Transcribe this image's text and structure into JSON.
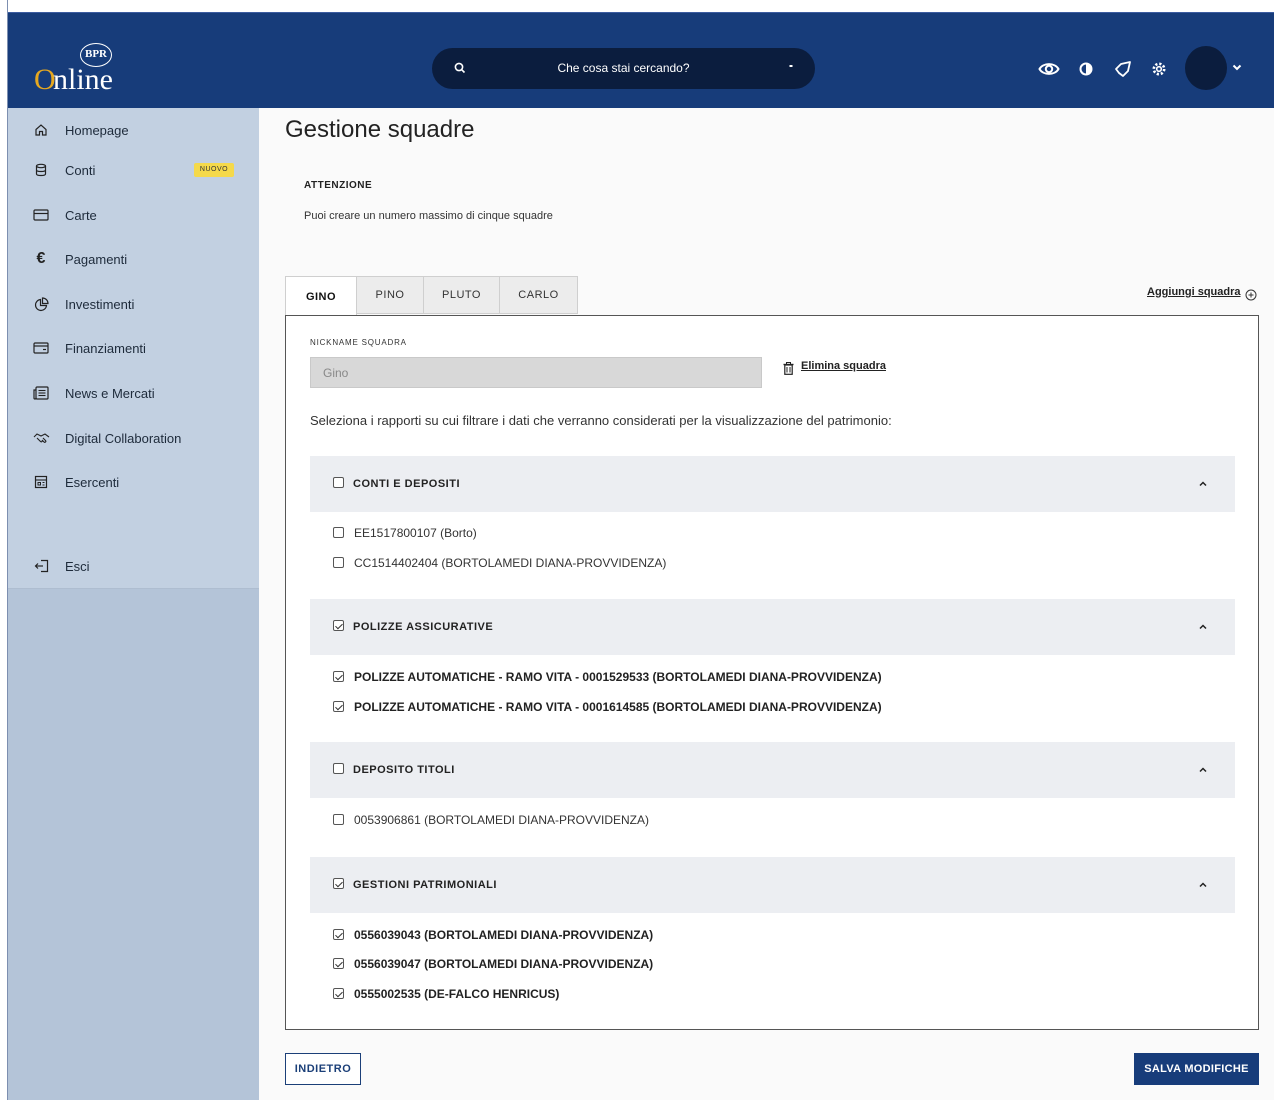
{
  "header": {
    "logo_text_o": "O",
    "logo_text_rest": "nline",
    "logo_seal": "BPR",
    "search_placeholder": "Che cosa stai cercando?",
    "icons": [
      "search-icon",
      "eye-icon",
      "contrast-icon",
      "rocket-icon",
      "gear-icon",
      "avatar",
      "chevron-down-icon"
    ]
  },
  "sidebar": {
    "items": [
      {
        "label": "Homepage",
        "icon": "home-icon"
      },
      {
        "label": "Conti",
        "icon": "database-icon",
        "badge": "NUOVO"
      },
      {
        "label": "Carte",
        "icon": "card-icon"
      },
      {
        "label": "Pagamenti",
        "icon": "euro-icon"
      },
      {
        "label": "Investimenti",
        "icon": "pie-chart-icon"
      },
      {
        "label": "Finanziamenti",
        "icon": "wallet-icon"
      },
      {
        "label": "News e Mercati",
        "icon": "news-icon"
      },
      {
        "label": "Digital Collaboration",
        "icon": "handshake-icon"
      },
      {
        "label": "Esercenti",
        "icon": "store-icon"
      }
    ],
    "logout": {
      "label": "Esci",
      "icon": "logout-icon"
    }
  },
  "main": {
    "title": "Gestione squadre",
    "attention_title": "ATTENZIONE",
    "attention_text": "Puoi creare un numero massimo di cinque squadre",
    "tabs": [
      {
        "label": "GINO",
        "active": true
      },
      {
        "label": "PINO",
        "active": false
      },
      {
        "label": "PLUTO",
        "active": false
      },
      {
        "label": "CARLO",
        "active": false
      }
    ],
    "add_team_label": "Aggiungi squadra",
    "nickname_label": "NICKNAME SQUADRA",
    "nickname_value": "Gino",
    "delete_team_label": "Elimina squadra",
    "select_text": "Seleziona i rapporti su cui filtrare i dati che verranno considerati per la visualizzazione del patrimonio:",
    "groups": [
      {
        "title": "CONTI E DEPOSITI",
        "checked": false,
        "items": [
          {
            "label": "EE1517800107 (Borto)",
            "checked": false
          },
          {
            "label": "CC1514402404 (BORTOLAMEDI DIANA-PROVVIDENZA)",
            "checked": false
          }
        ]
      },
      {
        "title": "POLIZZE ASSICURATIVE",
        "checked": true,
        "items": [
          {
            "label": "POLIZZE AUTOMATICHE - RAMO VITA - 0001529533 (BORTOLAMEDI DIANA-PROVVIDENZA)",
            "checked": true
          },
          {
            "label": "POLIZZE AUTOMATICHE - RAMO VITA - 0001614585 (BORTOLAMEDI DIANA-PROVVIDENZA)",
            "checked": true
          }
        ]
      },
      {
        "title": "DEPOSITO TITOLI",
        "checked": false,
        "items": [
          {
            "label": "0053906861 (BORTOLAMEDI DIANA-PROVVIDENZA)",
            "checked": false
          }
        ]
      },
      {
        "title": "GESTIONI PATRIMONIALI",
        "checked": true,
        "items": [
          {
            "label": "0556039043 (BORTOLAMEDI DIANA-PROVVIDENZA)",
            "checked": true
          },
          {
            "label": "0556039047 (BORTOLAMEDI DIANA-PROVVIDENZA)",
            "checked": true
          },
          {
            "label": "0555002535 (DE-FALCO HENRICUS)",
            "checked": true
          }
        ]
      }
    ],
    "back_label": "INDIETRO",
    "save_label": "SALVA MODIFICHE"
  },
  "colors": {
    "header_bg": "#173c7a",
    "search_bg": "#0b1d3e",
    "sidebar_bg": "#c2d0e1",
    "badge_bg": "#f5d94a",
    "primary_button": "#173c7a"
  }
}
